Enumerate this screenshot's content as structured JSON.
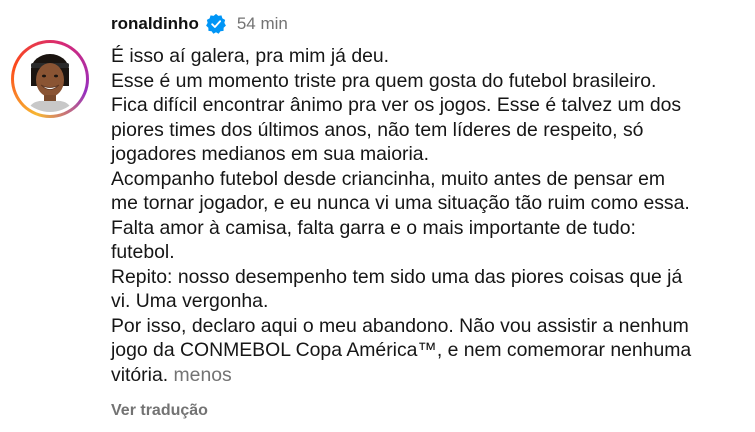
{
  "comment": {
    "username": "ronaldinho",
    "verified": true,
    "verified_color": "#0095f6",
    "time": "54 min",
    "lines": [
      "É isso aí galera, pra mim já deu.",
      "Esse é um momento triste pra quem gosta do futebol brasileiro.",
      "Fica difícil encontrar ânimo pra ver os jogos. Esse é talvez um dos",
      "piores times dos últimos anos, não tem líderes de respeito, só",
      "jogadores medianos em sua maioria.",
      "Acompanho futebol desde criancinha, muito antes de pensar em",
      "me tornar jogador, e eu nunca vi uma situação tão ruim como essa.",
      "Falta amor à camisa, falta garra e o mais importante de tudo:",
      "futebol.",
      "Repito: nosso desempenho tem sido uma das piores coisas que já",
      "vi. Uma vergonha.",
      "Por isso, declaro aqui o meu abandono. Não vou assistir a nenhum",
      "jogo da CONMEBOL Copa América™, e nem comemorar nenhuma",
      "vitória."
    ],
    "less_label": "menos",
    "translate_label": "Ver tradução",
    "avatar_icon": "profile-photo",
    "story_ring_colors": [
      "#f7b733",
      "#fc4a1a",
      "#d62976",
      "#962fbf"
    ]
  }
}
